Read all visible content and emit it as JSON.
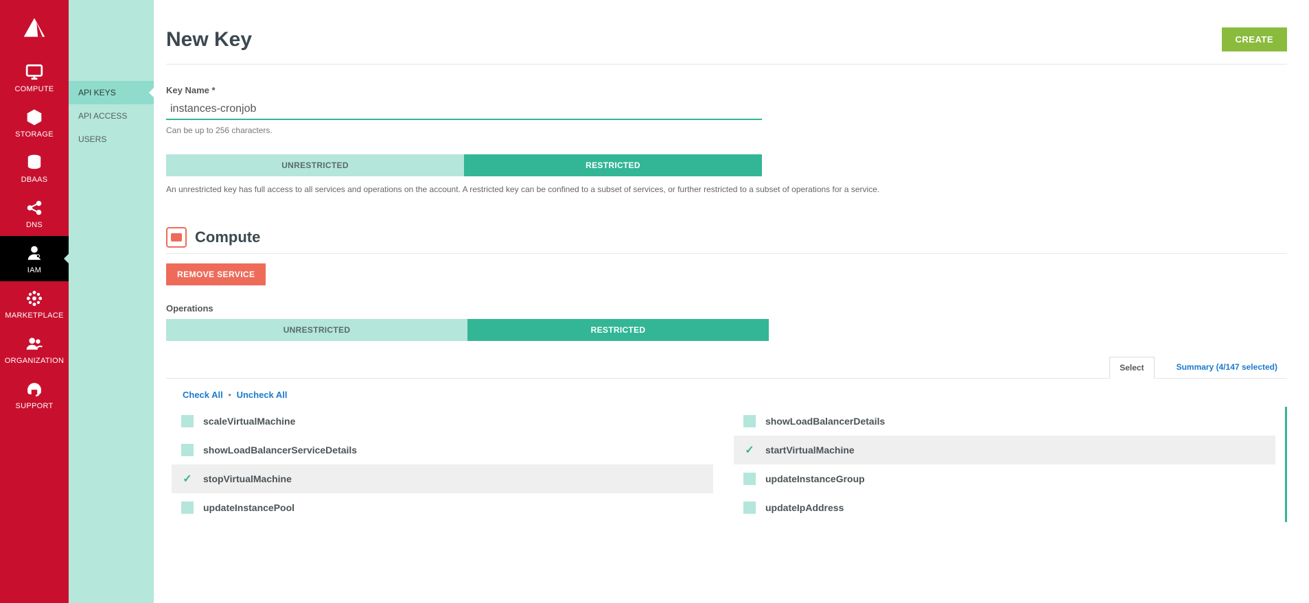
{
  "rail": {
    "items": [
      {
        "key": "compute",
        "label": "COMPUTE"
      },
      {
        "key": "storage",
        "label": "STORAGE"
      },
      {
        "key": "dbaas",
        "label": "DBAAS"
      },
      {
        "key": "dns",
        "label": "DNS"
      },
      {
        "key": "iam",
        "label": "IAM"
      },
      {
        "key": "marketplace",
        "label": "MARKETPLACE"
      },
      {
        "key": "organization",
        "label": "ORGANIZATION"
      },
      {
        "key": "support",
        "label": "SUPPORT"
      }
    ],
    "active": "iam"
  },
  "subnav": {
    "items": [
      {
        "key": "api-keys",
        "label": "API KEYS"
      },
      {
        "key": "api-access",
        "label": "API ACCESS"
      },
      {
        "key": "users",
        "label": "USERS"
      }
    ],
    "active": "api-keys"
  },
  "header": {
    "title": "New Key",
    "create_label": "CREATE"
  },
  "key_name": {
    "label": "Key Name *",
    "value": "instances-cronjob",
    "hint": "Can be up to 256 characters."
  },
  "restriction": {
    "options": {
      "unrestricted": "UNRESTRICTED",
      "restricted": "RESTRICTED"
    },
    "active": "restricted",
    "description": "An unrestricted key has full access to all services and operations on the account. A restricted key can be confined to a subset of services, or further restricted to a subset of operations for a service."
  },
  "service": {
    "name": "Compute",
    "remove_label": "REMOVE SERVICE",
    "ops_heading": "Operations",
    "ops_restriction_active": "restricted"
  },
  "tabs": {
    "select": "Select",
    "summary": "Summary (4/147 selected)",
    "active": "select"
  },
  "bulk": {
    "check_all": "Check All",
    "uncheck_all": "Uncheck All"
  },
  "operations": [
    {
      "key": "scaleVirtualMachine",
      "label": "scaleVirtualMachine",
      "selected": false
    },
    {
      "key": "showLoadBalancerDetails",
      "label": "showLoadBalancerDetails",
      "selected": false
    },
    {
      "key": "showLoadBalancerServiceDetails",
      "label": "showLoadBalancerServiceDetails",
      "selected": false
    },
    {
      "key": "startVirtualMachine",
      "label": "startVirtualMachine",
      "selected": true
    },
    {
      "key": "stopVirtualMachine",
      "label": "stopVirtualMachine",
      "selected": true
    },
    {
      "key": "updateInstanceGroup",
      "label": "updateInstanceGroup",
      "selected": false
    },
    {
      "key": "updateInstancePool",
      "label": "updateInstancePool",
      "selected": false
    },
    {
      "key": "updateIpAddress",
      "label": "updateIpAddress",
      "selected": false
    }
  ]
}
